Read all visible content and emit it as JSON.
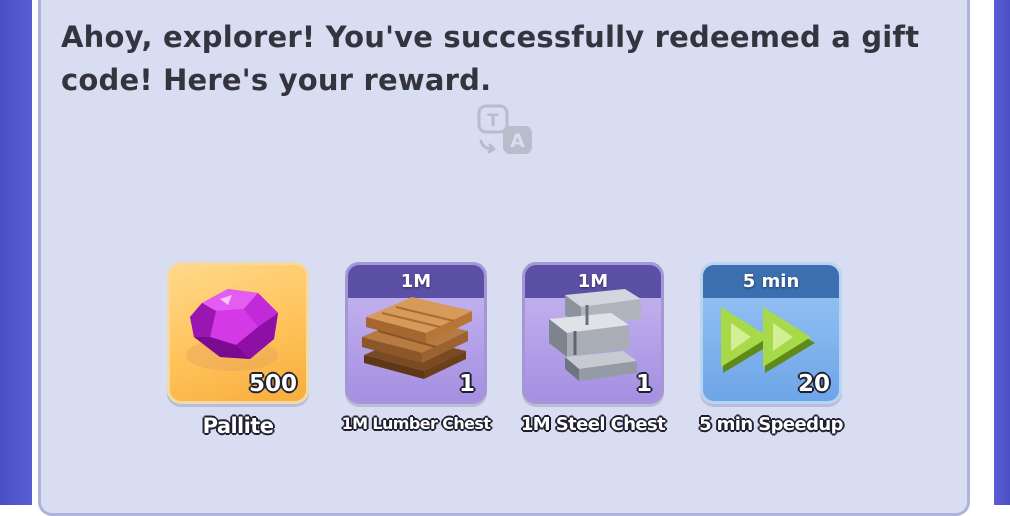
{
  "dialog": {
    "message": "Ahoy, explorer! You've successfully redeemed a gift code! Here's your reward."
  },
  "translate": {
    "icon": "translate-icon"
  },
  "rewards": [
    {
      "name": "Pallite",
      "quantity": "500",
      "ribbon": "",
      "icon": "gem-icon",
      "color": "#f7ad3b"
    },
    {
      "name": "1M Lumber Chest",
      "quantity": "1",
      "ribbon": "1M",
      "icon": "lumber-icon",
      "color": "#a58fe2"
    },
    {
      "name": "1M Steel Chest",
      "quantity": "1",
      "ribbon": "1M",
      "icon": "steel-icon",
      "color": "#a58fe2"
    },
    {
      "name": "5 min Speedup",
      "quantity": "20",
      "ribbon": "5 min",
      "icon": "fast-forward-icon",
      "color": "#6ea5e8"
    }
  ]
}
